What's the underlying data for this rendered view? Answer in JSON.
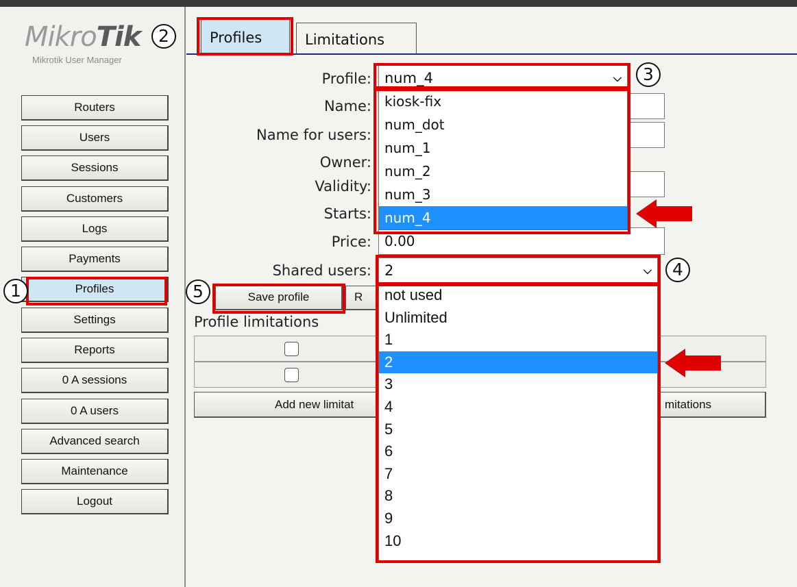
{
  "app": {
    "logo_text": "MikroTik",
    "subtitle": "Mikrotik User Manager"
  },
  "sidebar": {
    "items": [
      {
        "label": "Routers"
      },
      {
        "label": "Users"
      },
      {
        "label": "Sessions"
      },
      {
        "label": "Customers"
      },
      {
        "label": "Logs"
      },
      {
        "label": "Payments"
      },
      {
        "label": "Profiles",
        "active": true
      },
      {
        "label": "Settings"
      },
      {
        "label": "Reports"
      },
      {
        "label": "0 A sessions"
      },
      {
        "label": "0 A users"
      },
      {
        "label": "Advanced search"
      },
      {
        "label": "Maintenance"
      },
      {
        "label": "Logout"
      }
    ]
  },
  "tabs": [
    {
      "label": "Profiles",
      "active": true
    },
    {
      "label": "Limitations",
      "active": false
    }
  ],
  "form": {
    "profile_label": "Profile:",
    "profile_value": "num_4",
    "name_label": "Name:",
    "name_for_users_label": "Name for users:",
    "owner_label": "Owner:",
    "validity_label": "Validity:",
    "starts_label": "Starts:",
    "price_label": "Price:",
    "price_value": "0.00",
    "shared_users_label": "Shared users:",
    "shared_users_value": "2"
  },
  "profile_dropdown": {
    "options": [
      "kiosk-fix",
      "num_dot",
      "num_1",
      "num_2",
      "num_3",
      "num_4"
    ],
    "selected": "num_4"
  },
  "shared_users_dropdown": {
    "options": [
      "not used",
      "Unlimited",
      "1",
      "2",
      "3",
      "4",
      "5",
      "6",
      "7",
      "8",
      "9",
      "10"
    ],
    "selected": "2"
  },
  "buttons": {
    "save_profile": "Save profile",
    "partial_second": "R",
    "add_new_limitation": "Add new limitat",
    "limitations_partial": "mitations"
  },
  "limitations": {
    "title": "Profile limitations"
  },
  "annotations": [
    "1",
    "2",
    "3",
    "4",
    "5"
  ],
  "colors": {
    "highlight_red": "#e00000",
    "selection_blue": "#1e90ff",
    "active_button": "#cfe6f5"
  }
}
